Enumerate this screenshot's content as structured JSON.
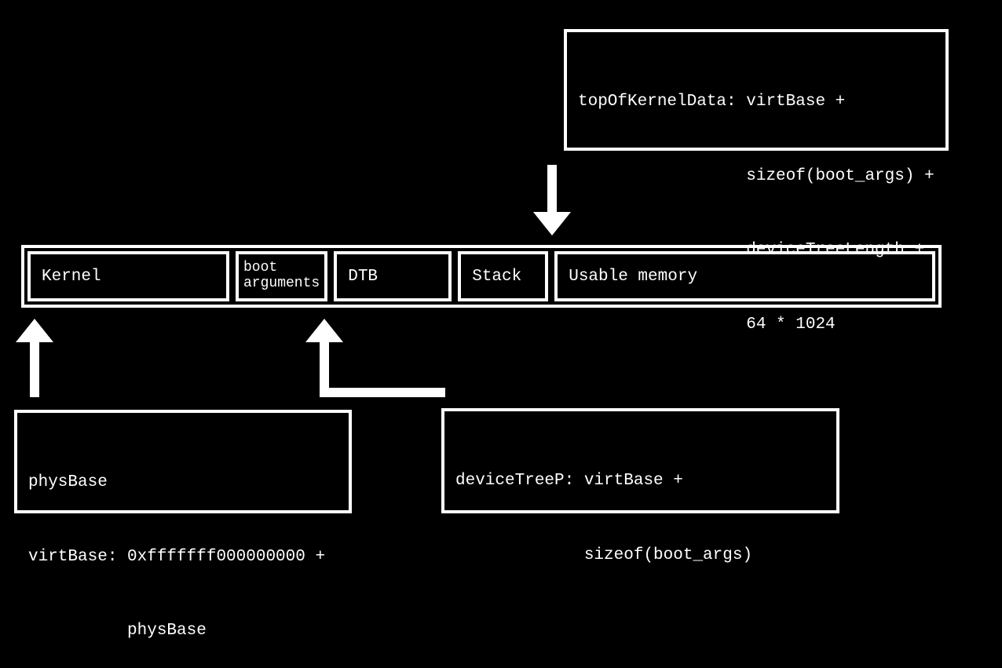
{
  "top_box": {
    "line1": "topOfKernelData: virtBase +",
    "line2": "                 sizeof(boot_args) +",
    "line3": "                 deviceTreeLength +",
    "line4": "                 64 * 1024"
  },
  "memory": {
    "kernel": "Kernel",
    "boot_args_line1": "boot",
    "boot_args_line2": "arguments",
    "dtb": "DTB",
    "stack": "Stack",
    "usable": "Usable memory"
  },
  "left_box": {
    "line1": "physBase",
    "line2": "virtBase: 0xfffffff000000000 +",
    "line3": "          physBase"
  },
  "right_box": {
    "line1": "deviceTreeP: virtBase +",
    "line2": "             sizeof(boot_args)"
  }
}
